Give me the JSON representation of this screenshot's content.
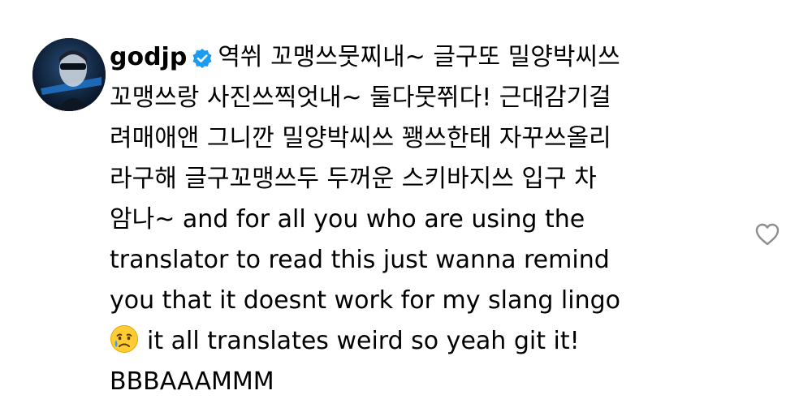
{
  "comment": {
    "username": "godjp",
    "verified_icon": "verified-badge-icon",
    "verified_color": "#1d9bf0",
    "text_color": "#000000",
    "lines": {
      "l1": "역쒸 꼬맹쓰뭇찌내~ 글구또 밀양박씨쓰",
      "l2": "꼬맹쓰랑 사진쓰찍엇내~ 둘다뭇쮜다! 근대감기걸",
      "l3": "려매애앤 그니깐 밀양박씨쓰 꽹쓰한태 자꾸쓰올리",
      "l4": "라구해 글구꼬맹쓰두 두꺼운 스키바지쓰 입구 차",
      "l5": "암나~ and for all you who are using the",
      "l6": "translator to read this just wanna remind",
      "l7": "you that it doesnt work for my slang lingo",
      "l8": "it all translates weird so yeah git it!",
      "l9": "BBBAAAMMM"
    },
    "emoji_icon": "crying-face-emoji-icon",
    "like_icon": "heart-outline-icon",
    "like_icon_color": "#8e8e8e"
  }
}
